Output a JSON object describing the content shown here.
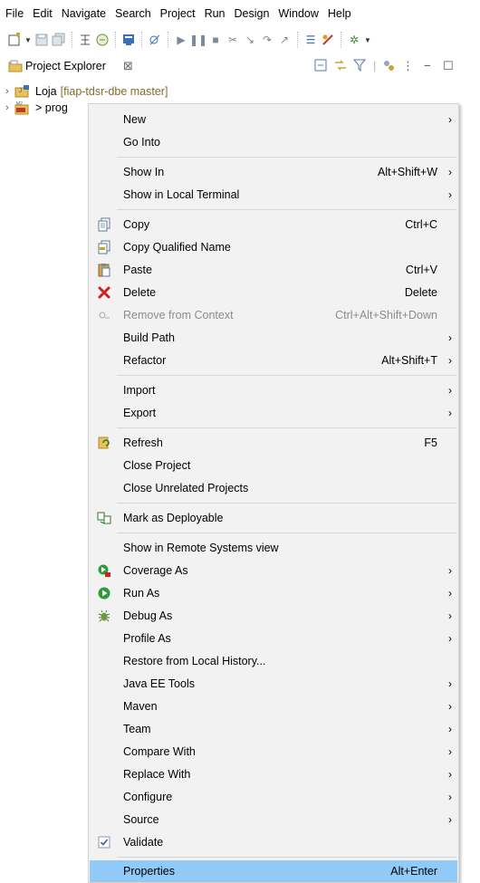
{
  "menubar": [
    "File",
    "Edit",
    "Navigate",
    "Search",
    "Project",
    "Run",
    "Design",
    "Window",
    "Help"
  ],
  "view": {
    "title": "Project Explorer",
    "close_glyph": "⊠"
  },
  "tree": [
    {
      "name": "Loja",
      "decoration": "[fiap-tdsr-dbe master]",
      "icon": "maven-project-icon"
    },
    {
      "name": "> prog",
      "decoration": "",
      "icon": "maven-web-project-icon"
    }
  ],
  "context_menu": {
    "items": [
      {
        "label": "New",
        "accel": "",
        "submenu": true,
        "icon": ""
      },
      {
        "label": "Go Into",
        "accel": "",
        "submenu": false,
        "icon": ""
      },
      {
        "label": "Show In",
        "accel": "Alt+Shift+W",
        "submenu": true,
        "icon": ""
      },
      {
        "label": "Show in Local Terminal",
        "accel": "",
        "submenu": true,
        "icon": ""
      },
      {
        "label": "Copy",
        "accel": "Ctrl+C",
        "submenu": false,
        "icon": "copy-icon"
      },
      {
        "label": "Copy Qualified Name",
        "accel": "",
        "submenu": false,
        "icon": "copy-qualified-name-icon"
      },
      {
        "label": "Paste",
        "accel": "Ctrl+V",
        "submenu": false,
        "icon": "paste-icon"
      },
      {
        "label": "Delete",
        "accel": "Delete",
        "submenu": false,
        "icon": "delete-icon"
      },
      {
        "label": "Remove from Context",
        "accel": "Ctrl+Alt+Shift+Down",
        "submenu": false,
        "icon": "remove-context-icon",
        "disabled": true
      },
      {
        "label": "Build Path",
        "accel": "",
        "submenu": true,
        "icon": ""
      },
      {
        "label": "Refactor",
        "accel": "Alt+Shift+T",
        "submenu": true,
        "icon": ""
      },
      {
        "label": "Import",
        "accel": "",
        "submenu": true,
        "icon": ""
      },
      {
        "label": "Export",
        "accel": "",
        "submenu": true,
        "icon": ""
      },
      {
        "label": "Refresh",
        "accel": "F5",
        "submenu": false,
        "icon": "refresh-icon"
      },
      {
        "label": "Close Project",
        "accel": "",
        "submenu": false,
        "icon": ""
      },
      {
        "label": "Close Unrelated Projects",
        "accel": "",
        "submenu": false,
        "icon": ""
      },
      {
        "label": "Mark as Deployable",
        "accel": "",
        "submenu": false,
        "icon": "deployable-icon"
      },
      {
        "label": "Show in Remote Systems view",
        "accel": "",
        "submenu": false,
        "icon": ""
      },
      {
        "label": "Coverage As",
        "accel": "",
        "submenu": true,
        "icon": "coverage-icon"
      },
      {
        "label": "Run As",
        "accel": "",
        "submenu": true,
        "icon": "run-icon"
      },
      {
        "label": "Debug As",
        "accel": "",
        "submenu": true,
        "icon": "debug-bug-icon"
      },
      {
        "label": "Profile As",
        "accel": "",
        "submenu": true,
        "icon": ""
      },
      {
        "label": "Restore from Local History...",
        "accel": "",
        "submenu": false,
        "icon": ""
      },
      {
        "label": "Java EE Tools",
        "accel": "",
        "submenu": true,
        "icon": ""
      },
      {
        "label": "Maven",
        "accel": "",
        "submenu": true,
        "icon": ""
      },
      {
        "label": "Team",
        "accel": "",
        "submenu": true,
        "icon": ""
      },
      {
        "label": "Compare With",
        "accel": "",
        "submenu": true,
        "icon": ""
      },
      {
        "label": "Replace With",
        "accel": "",
        "submenu": true,
        "icon": ""
      },
      {
        "label": "Configure",
        "accel": "",
        "submenu": true,
        "icon": ""
      },
      {
        "label": "Source",
        "accel": "",
        "submenu": true,
        "icon": ""
      },
      {
        "label": "Validate",
        "accel": "",
        "submenu": false,
        "icon": "checkbox-checked-icon"
      },
      {
        "label": "Properties",
        "accel": "Alt+Enter",
        "submenu": false,
        "icon": "",
        "selected": true
      }
    ],
    "submenu_arrow": "›",
    "colors": {
      "selection": "#91c9f7",
      "background": "#f2f2f2",
      "disabled_text": "#8c8c8c"
    }
  }
}
